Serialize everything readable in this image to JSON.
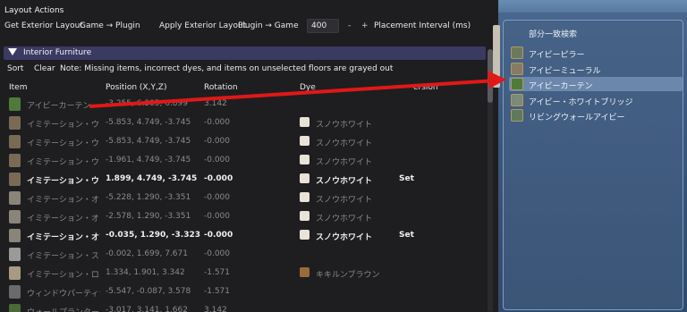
{
  "panel": {
    "section_title": "Layout Actions",
    "toolbar": {
      "get_exterior": "Get Exterior Layout",
      "game_to_plugin": "Game → Plugin",
      "apply_exterior": "Apply Exterior Layout",
      "plugin_to_game": "Plugin → Game",
      "interval_value": "400",
      "minus": "-",
      "plus": "+",
      "interval_label": "Placement Interval (ms)"
    },
    "collapse_label": "Interior Furniture",
    "subbar": {
      "sort": "Sort",
      "clear": "Clear",
      "note": "Note: Missing items, incorrect dyes, and items on unselected floors are grayed out"
    },
    "columns": {
      "item": "Item",
      "position": "Position (X,Y,Z)",
      "rotation": "Rotation",
      "dye": "Dye",
      "last": "ersion"
    },
    "rows": [
      {
        "name": "アイビーカーテン",
        "pos": "-3.255, 6.305, 6.899",
        "rot": "3.142",
        "dye": "",
        "set": "",
        "state": "grayed",
        "thumb": "#4f7a3a",
        "dye_color": ""
      },
      {
        "name": "イミテーション・ウッド",
        "pos": "-5.853, 4.749, -3.745",
        "rot": "-0.000",
        "dye": "スノウホワイト",
        "set": "",
        "state": "grayed",
        "thumb": "#7a6a55",
        "dye_color": "#e8e2d8"
      },
      {
        "name": "イミテーション・ウッド",
        "pos": "-5.853, 4.749, -3.745",
        "rot": "-0.000",
        "dye": "スノウホワイト",
        "set": "",
        "state": "grayed",
        "thumb": "#7a6a55",
        "dye_color": "#e8e2d8"
      },
      {
        "name": "イミテーション・ウッド",
        "pos": "-1.961, 4.749, -3.745",
        "rot": "-0.000",
        "dye": "スノウホワイト",
        "set": "",
        "state": "grayed",
        "thumb": "#7a6a55",
        "dye_color": "#e8e2d8"
      },
      {
        "name": "イミテーション・ウッド",
        "pos": "1.899, 4.749, -3.745",
        "rot": "-0.000",
        "dye": "スノウホワイト",
        "set": "Set",
        "state": "bright",
        "thumb": "#7a6a55",
        "dye_color": "#e8e2d8"
      },
      {
        "name": "イミテーション・オブジ",
        "pos": "-5.228, 1.290, -3.351",
        "rot": "-0.000",
        "dye": "スノウホワイト",
        "set": "",
        "state": "grayed",
        "thumb": "#8a8578",
        "dye_color": "#e8e2d8"
      },
      {
        "name": "イミテーション・オブジ",
        "pos": "-2.578, 1.290, -3.351",
        "rot": "-0.000",
        "dye": "スノウホワイト",
        "set": "",
        "state": "grayed",
        "thumb": "#8a8578",
        "dye_color": "#e8e2d8"
      },
      {
        "name": "イミテーション・オブジ",
        "pos": "-0.035, 1.290, -3.323",
        "rot": "-0.000",
        "dye": "スノウホワイト",
        "set": "Set",
        "state": "bright",
        "thumb": "#8a8578",
        "dye_color": "#e8e2d8"
      },
      {
        "name": "イミテーション・スモー",
        "pos": "-0.002, 1.699, 7.671",
        "rot": "-0.000",
        "dye": "",
        "set": "",
        "state": "grayed",
        "thumb": "#9a9a9a",
        "dye_color": ""
      },
      {
        "name": "イミテーション・ロング",
        "pos": "1.334, 1.901, 3.342",
        "rot": "-1.571",
        "dye": "キキルンブラウン",
        "set": "",
        "state": "grayed",
        "thumb": "#a89a82",
        "dye_color": "#9a6a3a"
      },
      {
        "name": "ウィンドウパーティショ",
        "pos": "-5.547, -0.087, 3.578",
        "rot": "-1.571",
        "dye": "",
        "set": "",
        "state": "grayed",
        "thumb": "#6a6a6a",
        "dye_color": ""
      },
      {
        "name": "ウォールプランター",
        "pos": "-3.017, 3.141, 1.662",
        "rot": "3.142",
        "dye": "",
        "set": "",
        "state": "grayed",
        "thumb": "#4a6a3a",
        "dye_color": ""
      }
    ]
  },
  "search_window": {
    "title": "部分一致検索",
    "items": [
      {
        "label": "アイビーピラー",
        "selected": false,
        "icon_color": "#6c7a5a"
      },
      {
        "label": "アイビーミューラル",
        "selected": false,
        "icon_color": "#8a7a62"
      },
      {
        "label": "アイビーカーテン",
        "selected": true,
        "icon_color": "#4f7a3a"
      },
      {
        "label": "アイビー・ホワイトブリッジ",
        "selected": false,
        "icon_color": "#7c8a78"
      },
      {
        "label": "リビングウォールアイビー",
        "selected": false,
        "icon_color": "#5f7a5a"
      }
    ]
  },
  "colors": {
    "panel_bg": "#1e1e20",
    "header_accent": "#3a3a63",
    "arrow": "#e01818"
  }
}
